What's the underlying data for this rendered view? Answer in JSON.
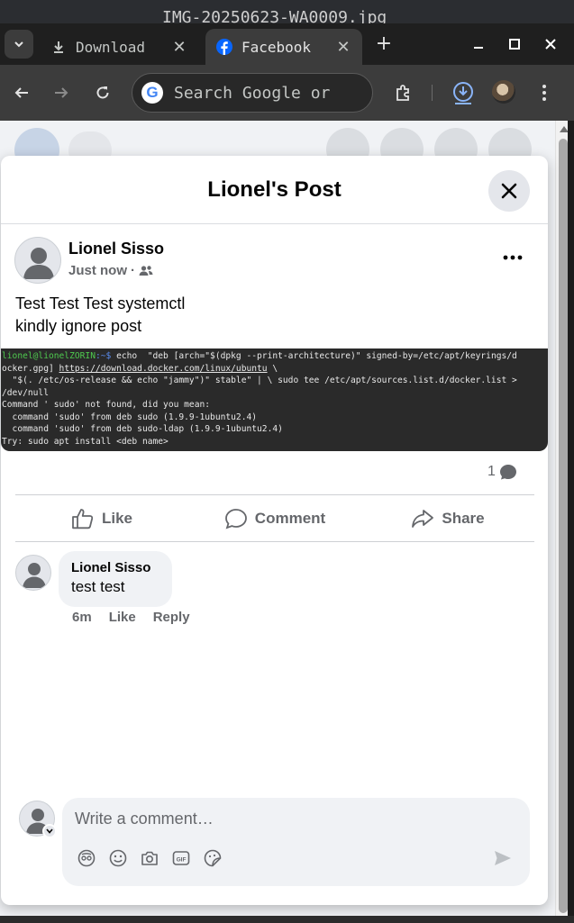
{
  "behind": {
    "filename": "IMG-20250623-WA0009.jpg"
  },
  "tabs": [
    {
      "label": "Download",
      "icon": "download-icon",
      "active": false
    },
    {
      "label": "Facebook",
      "icon": "facebook-icon",
      "active": true
    }
  ],
  "omnibox": {
    "placeholder": "Search Google or"
  },
  "dialog": {
    "title": "Lionel's Post",
    "post": {
      "author": "Lionel Sisso",
      "timestamp": "Just now",
      "separator": "·",
      "audience_icon": "friends-icon",
      "text_lines": [
        "Test Test Test systemctl",
        "kindly ignore post"
      ]
    },
    "terminal": {
      "user": "lionel@lionelZORIN",
      "path": ":~$",
      "line1_cmd": " echo  \"deb [arch=\"$(dpkg --print-architecture)\" signed-by=/etc/apt/keyrings/d",
      "line2_pre": "ocker.gpg] ",
      "line2_link": "https://download.docker.com/linux/ubuntu",
      "line2_post": " \\",
      "line3": "  \"$(. /etc/os-release && echo \"jammy\")\" stable\" | \\ sudo tee /etc/apt/sources.list.d/docker.list >",
      "line4": "/dev/null",
      "line5": "Command ' sudo' not found, did you mean:",
      "line6": "  command 'sudo' from deb sudo (1.9.9-1ubuntu2.4)",
      "line7": "  command 'sudo' from deb sudo-ldap (1.9.9-1ubuntu2.4)",
      "line8": "Try: sudo apt install <deb name>"
    },
    "comment_count": "1",
    "actions": {
      "like": "Like",
      "comment": "Comment",
      "share": "Share"
    },
    "comments": [
      {
        "author": "Lionel Sisso",
        "text": "test test",
        "time": "6m",
        "like": "Like",
        "reply": "Reply"
      }
    ],
    "composer": {
      "placeholder": "Write a comment…"
    }
  },
  "colors": {
    "facebook_blue": "#0866ff",
    "text_primary": "#050505",
    "text_secondary": "#65676b",
    "terminal_bg": "#2a2a2a",
    "terminal_user": "#4ec94e",
    "terminal_path": "#5b8def"
  }
}
